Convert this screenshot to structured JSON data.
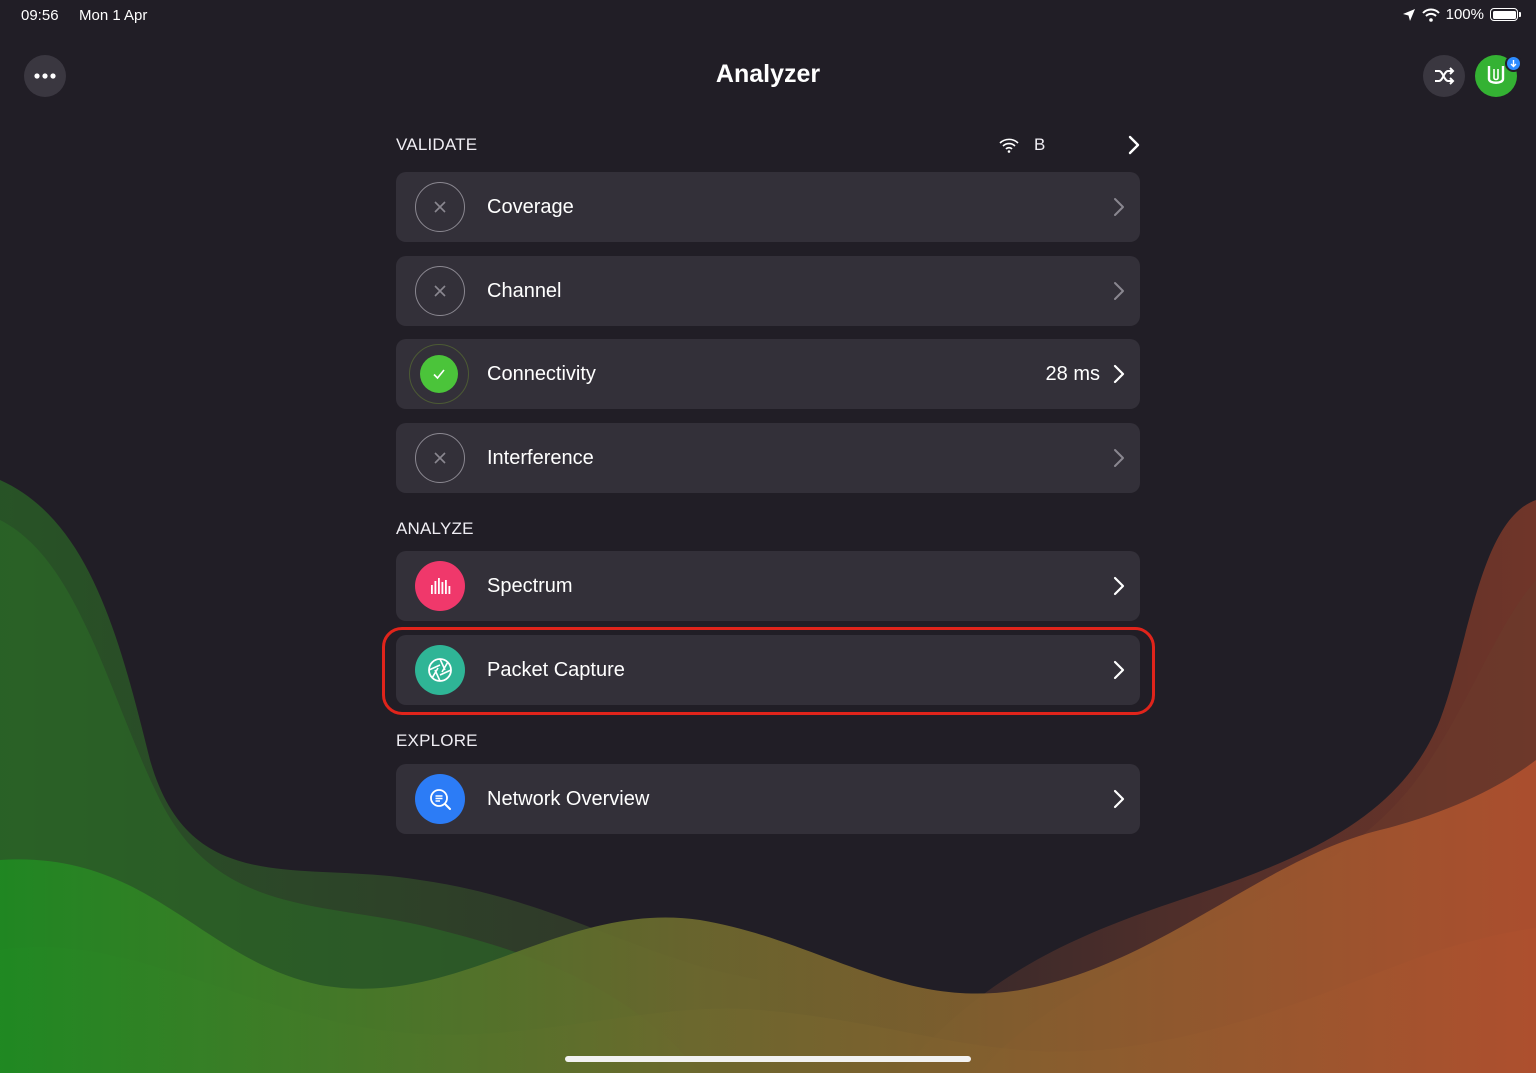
{
  "status_bar": {
    "time": "09:56",
    "date": "Mon 1 Apr",
    "battery": "100%",
    "icons": [
      "location-arrow-icon",
      "wifi-icon",
      "battery-icon"
    ]
  },
  "nav": {
    "title": "Analyzer",
    "more_icon": "ellipsis-icon",
    "shuffle_icon": "shuffle-icon",
    "avatar_icon": "app-badge-icon",
    "badge_icon": "download-arrow-icon"
  },
  "sections": {
    "validate": {
      "header": "VALIDATE",
      "network_name": "B",
      "items": [
        {
          "label": "Coverage",
          "value": "",
          "status": "not-run"
        },
        {
          "label": "Channel",
          "value": "",
          "status": "not-run"
        },
        {
          "label": "Connectivity",
          "value": "28 ms",
          "status": "passed"
        },
        {
          "label": "Interference",
          "value": "",
          "status": "not-run"
        }
      ]
    },
    "analyze": {
      "header": "ANALYZE",
      "items": [
        {
          "label": "Spectrum",
          "icon": "spectrum-bars-icon"
        },
        {
          "label": "Packet Capture",
          "icon": "aperture-icon"
        }
      ]
    },
    "explore": {
      "header": "EXPLORE",
      "items": [
        {
          "label": "Network Overview",
          "icon": "magnifier-icon"
        }
      ]
    }
  },
  "colors": {
    "background": "#211e26",
    "row": "#333039",
    "success": "#4bc43a",
    "spectrum": "#f0386b",
    "packet_capture": "#2fb596",
    "network_overview": "#2c7cf6",
    "highlight": "#e0241b"
  }
}
